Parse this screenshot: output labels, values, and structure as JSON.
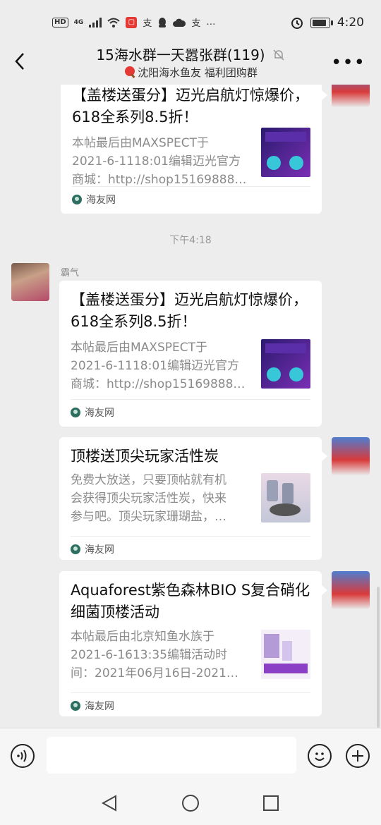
{
  "status_bar": {
    "network_badge": "HD",
    "signal_label": "4G",
    "app_label_1": "支",
    "app_label_2": "支",
    "more_dots": "…",
    "time": "4:20",
    "battery_level": 0.85
  },
  "header": {
    "title": "15海水群一天嚣张群(119)",
    "subtitle": "沈阳海水鱼友   福利团购群"
  },
  "chat": {
    "timestamp": "下午4:18",
    "messages": [
      {
        "title": "【盖楼送蛋分】迈光启航灯惊爆价，618全系列8.5折！",
        "title_visible": "【盖楼送蛋分】迈光启航灯惊爆价，618全系列8.5折！",
        "desc_lines": [
          "本帖最后由MAXSPECT于",
          "2021-6-1118:01编辑迈光官方",
          "商城：http://shop15169888…"
        ],
        "source": "海友网"
      },
      {
        "sender": "霸气",
        "title": "【盖楼送蛋分】迈光启航灯惊爆价，618全系列8.5折！",
        "desc_lines": [
          "本帖最后由MAXSPECT于",
          "2021-6-1118:01编辑迈光官方",
          "商城：http://shop15169888…"
        ],
        "source": "海友网"
      },
      {
        "title": "顶楼送顶尖玩家活性炭",
        "desc_lines": [
          "免费大放送，只要顶帖就有机",
          "会获得顶尖玩家活性炭，快来",
          "参与吧。顶尖玩家珊瑚盐，…"
        ],
        "source": "海友网"
      },
      {
        "title": "Aquaforest紫色森林BIO S复合硝化细菌顶楼活动",
        "desc_lines": [
          "本帖最后由北京知鱼水族于",
          "2021-6-1613:35编辑活动时",
          "间：2021年06月16日-2021…"
        ],
        "source": "海友网"
      }
    ]
  }
}
